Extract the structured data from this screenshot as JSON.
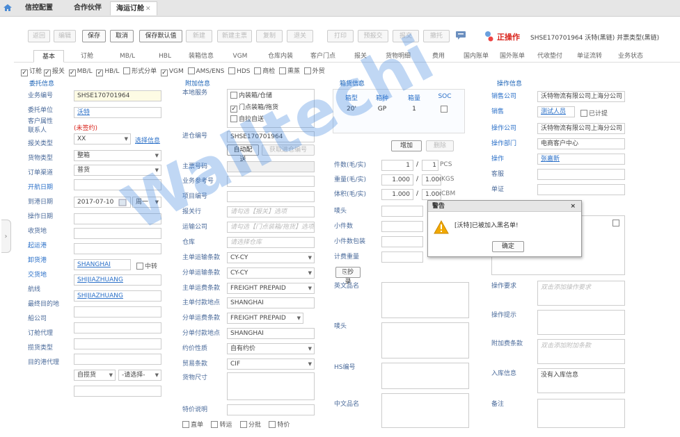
{
  "nav": {
    "tabs": [
      "信控配置",
      "合作伙伴",
      "海运订舱"
    ]
  },
  "toolbar": {
    "buttons": [
      "返回",
      "编辑",
      "保存",
      "取消",
      "保存默认值",
      "新建",
      "新建主票",
      "复制",
      "退关",
      "打印",
      "预报交",
      "报交",
      "撤托"
    ],
    "status_label": "正操作",
    "status_text": "SHSE170701964 沃特(黑链)  并票类型(黑链)"
  },
  "tabs": [
    "基本",
    "订舱",
    "MB/L",
    "HBL",
    "装箱信息",
    "VGM",
    "仓库内装",
    "客户门点",
    "报关",
    "货物明细",
    "费用",
    "国内账单",
    "国外账单",
    "代收垫付",
    "单证流转",
    "业务状态"
  ],
  "checks": [
    {
      "label": "订舱",
      "c": true
    },
    {
      "label": "报关",
      "c": true
    },
    {
      "label": "MB/L",
      "c": true
    },
    {
      "label": "HB/L",
      "c": true
    },
    {
      "label": "形式分单",
      "c": false
    },
    {
      "label": "VGM",
      "c": true
    },
    {
      "label": "AMS/ENS",
      "c": false
    },
    {
      "label": "HDS",
      "c": false
    },
    {
      "label": "商检",
      "c": false
    },
    {
      "label": "熏蒸",
      "c": false
    },
    {
      "label": "外贸",
      "c": false
    }
  ],
  "s1": {
    "title": "委托信息",
    "labels": [
      "业务编号",
      "委托单位",
      "客户属性",
      "联系人",
      "报关类型",
      "货物类型",
      "订单渠道",
      "开航日期",
      "到港日期",
      "操作日期",
      "收货地",
      "起运港",
      "卸货港",
      "交货地",
      "航线",
      "最终目的地",
      "船公司",
      "订舱代理",
      "揽货类型",
      "目的港代理"
    ],
    "job_no": "SHSE170701964",
    "client": "沃特",
    "client_attr": "(未签约)",
    "contact": "XX",
    "contact_link": "选择信息",
    "customs_type": "整箱",
    "goods_type": "普货",
    "sail_date": "2017-07-10",
    "weekday": "周一",
    "pol": "SHANGHAI",
    "transship": "中转",
    "pod": "SHIJIAZHUANG",
    "delivery": "SHIJIAZHUANG",
    "solicit": "自揽货",
    "solicit2": "-请选择-"
  },
  "s2": {
    "title": "附加信息",
    "labels": [
      "本地服务",
      "进仓编号",
      "主票号码",
      "业务参考号",
      "项目编号",
      "报关行",
      "运输公司",
      "仓库",
      "主单运输条款",
      "分单运输条款",
      "主单运费条款",
      "主单付款地点",
      "分单运费条款",
      "分单付款地点",
      "约价性质",
      "贸易条款",
      "货物尺寸",
      "特价说明"
    ],
    "svc": [
      {
        "t": "内装箱/仓储",
        "c": false
      },
      {
        "t": "门点装箱/拖货",
        "c": true
      },
      {
        "t": "自拉自送",
        "c": false
      }
    ],
    "wh_no": "SHSE170701964",
    "btn_auto": "自动配送",
    "btn_get": "获取进仓编号",
    "ph_broker": "请勾选【报关】选项",
    "ph_trans": "请勾选【门点装箱/拖货】选项",
    "ph_wh": "请选择仓库",
    "main_term": "CY-CY",
    "sub_term": "CY-CY",
    "main_freight": "FREIGHT PREPAID",
    "main_pay": "SHANGHAI",
    "sub_freight": "FREIGHT PREPAID",
    "sub_pay": "SHANGHAI",
    "price_nature": "自有约价",
    "trade_term": "CIF",
    "bottom": [
      "直单",
      "转运",
      "分批",
      "特价"
    ]
  },
  "s3": {
    "title": "箱货信息",
    "heads": [
      "箱型",
      "箱种",
      "箱量",
      "SOC"
    ],
    "row": [
      "20'",
      "GP",
      "1"
    ],
    "add": "增加",
    "del": "删除",
    "labels": [
      "件数(毛/实)",
      "重量(毛/实)",
      "体积(毛/实)",
      "唛头",
      "小件数",
      "小件数包装",
      "计费重量",
      "中文品名",
      "唛头",
      "HS编号",
      "中文品名"
    ],
    "pcs1": "1",
    "pcs2": "1",
    "pcs_unit": "PCS",
    "wt1": "1.000",
    "wt2": "1.000",
    "wt_unit": "KGS",
    "vol1": "1.000",
    "vol2": "1.000",
    "vol_unit": "CBM",
    "copy": "抄录",
    "en_name": "英文品名"
  },
  "s4": {
    "title": "操作信息",
    "labels": [
      "销售公司",
      "销售",
      "操作公司",
      "操作部门",
      "操作",
      "客服",
      "单证",
      "操作要求",
      "操作提示",
      "附加费条款",
      "入库信息",
      "备注"
    ],
    "sales_co": "沃特物流有限公司上海分公司",
    "sales": "测试人员",
    "tick": "已计提",
    "op_co": "沃特物流有限公司上海分公司",
    "op_dept": "电商客户中心",
    "op": "张嘉新",
    "ph_req": "双击添加操作要求",
    "ph_fee": "双击添加附加条款",
    "store": "没有入库信息"
  },
  "modal": {
    "title": "警告",
    "msg": "[沃特]已被加入黑名单!",
    "ok": "确定"
  },
  "watermark": "Walltechi"
}
